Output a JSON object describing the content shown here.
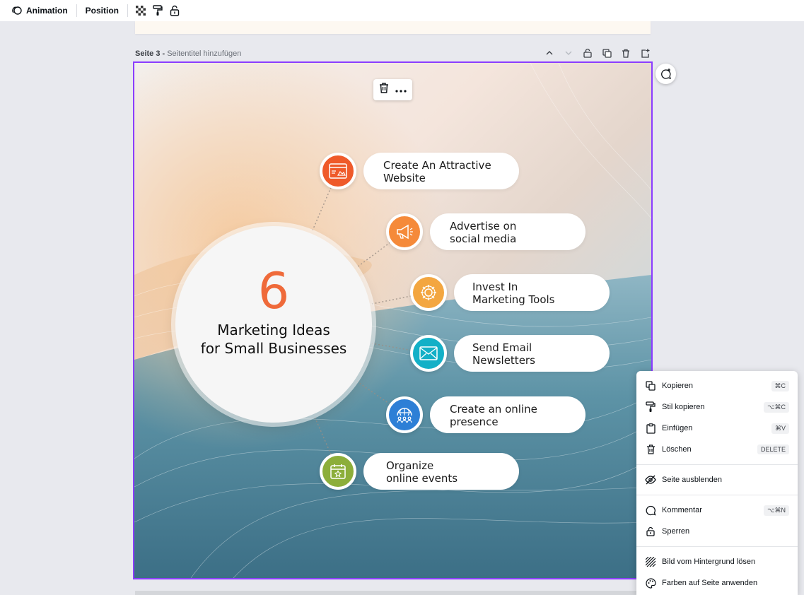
{
  "toolbar": {
    "animation_label": "Animation",
    "position_label": "Position",
    "icons": [
      "animation-icon",
      "transparency-icon",
      "style-paint-icon",
      "lock-icon"
    ]
  },
  "page": {
    "number": "Seite 3 -",
    "title_placeholder": "Seitentitel hinzufügen",
    "actions": [
      "chevron-up-icon",
      "chevron-down-icon",
      "lock-icon",
      "duplicate-icon",
      "trash-icon",
      "add-page-icon"
    ]
  },
  "design": {
    "big_number": "6",
    "title_line1": "Marketing Ideas",
    "title_line2": "for Small Businesses",
    "ideas": [
      {
        "line1": "Create An Attractive",
        "line2": "Website",
        "color": "#ef5a2a",
        "icon": "website-icon"
      },
      {
        "line1": "Advertise on",
        "line2": "social media",
        "color": "#f58a3a",
        "icon": "megaphone-icon"
      },
      {
        "line1": "Invest In",
        "line2": "Marketing Tools",
        "color": "#f3a640",
        "icon": "gear-icon"
      },
      {
        "line1": "Send Email",
        "line2": "Newsletters",
        "color": "#13b0c7",
        "icon": "envelope-icon"
      },
      {
        "line1": "Create an online",
        "line2": "presence",
        "color": "#2d7fd6",
        "icon": "globe-people-icon"
      },
      {
        "line1": "Organize",
        "line2": "online events",
        "color": "#8cae3a",
        "icon": "calendar-star-icon"
      }
    ]
  },
  "context_menu": {
    "items": [
      {
        "label": "Kopieren",
        "shortcut": "⌘C",
        "icon": "copy-icon"
      },
      {
        "label": "Stil kopieren",
        "shortcut": "⌥⌘C",
        "icon": "paint-roller-icon"
      },
      {
        "label": "Einfügen",
        "shortcut": "⌘V",
        "icon": "clipboard-icon"
      },
      {
        "label": "Löschen",
        "shortcut": "DELETE",
        "icon": "trash-icon"
      },
      {
        "label": "Seite ausblenden",
        "shortcut": "",
        "icon": "eye-off-icon"
      },
      {
        "label": "Kommentar",
        "shortcut": "⌥⌘N",
        "icon": "comment-icon"
      },
      {
        "label": "Sperren",
        "shortcut": "",
        "icon": "lock-icon"
      },
      {
        "label": "Bild vom Hintergrund lösen",
        "shortcut": "",
        "icon": "detach-image-icon"
      },
      {
        "label": "Farben auf Seite anwenden",
        "shortcut": "",
        "icon": "palette-icon"
      }
    ]
  }
}
